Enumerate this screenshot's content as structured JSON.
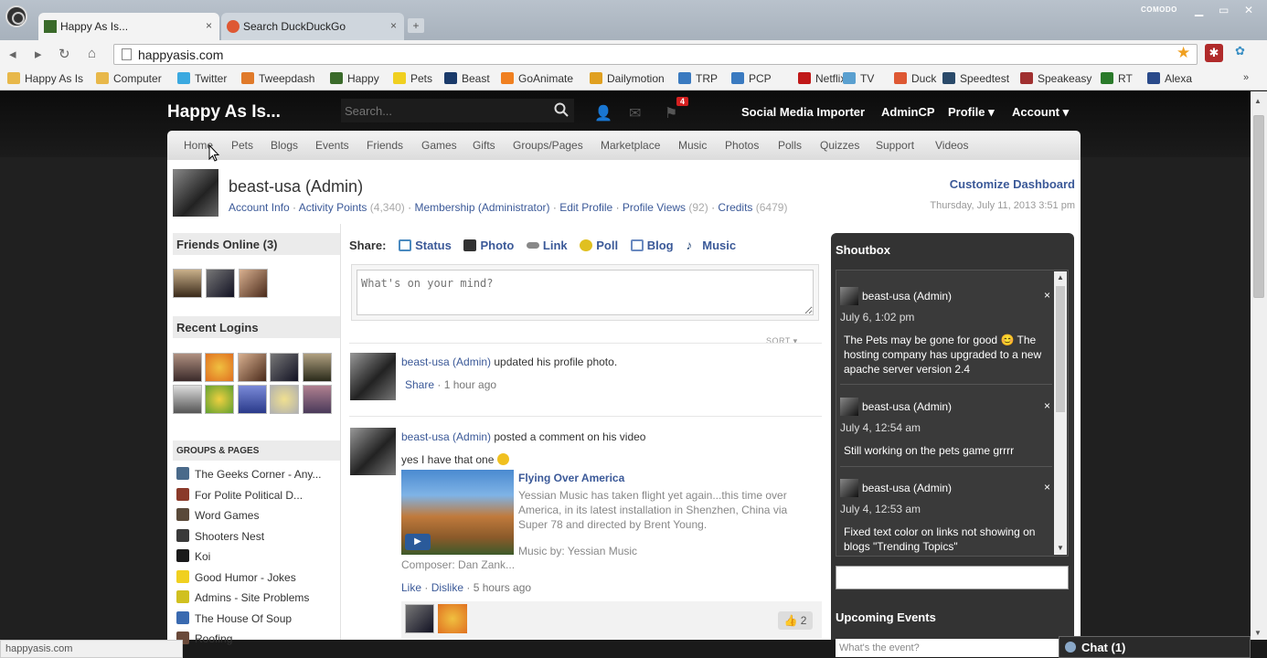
{
  "browser": {
    "tabs": [
      {
        "title": "Happy As Is...",
        "active": true
      },
      {
        "title": "Search DuckDuckGo",
        "active": false
      }
    ],
    "close_glyph": "×",
    "new_tab_glyph": "+",
    "brand": "COMODO",
    "url": "happyasis.com",
    "bookmarks": [
      {
        "label": "Happy As Is",
        "icon": "folder-icon",
        "color": "#e8b84a"
      },
      {
        "label": "Computer",
        "icon": "folder-icon",
        "color": "#e8b84a"
      },
      {
        "label": "Twitter",
        "icon": "twitter-icon",
        "color": "#3ba9e0"
      },
      {
        "label": "Tweepdash",
        "icon": "tweepdash-icon",
        "color": "#e07a2a"
      },
      {
        "label": "Happy",
        "icon": "happy-icon",
        "color": "#3a6a2a"
      },
      {
        "label": "Pets",
        "icon": "smiley-icon",
        "color": "#f0d020"
      },
      {
        "label": "Beast",
        "icon": "beast-icon",
        "color": "#1a3a6a"
      },
      {
        "label": "GoAnimate",
        "icon": "goanimate-icon",
        "color": "#f08020"
      },
      {
        "label": "Dailymotion",
        "icon": "dailymotion-icon",
        "color": "#e0a020"
      },
      {
        "label": "TRP",
        "icon": "trp-icon",
        "color": "#3a7ac0"
      },
      {
        "label": "PCP",
        "icon": "pcp-icon",
        "color": "#3a7ac0"
      },
      {
        "label": "Netflix",
        "icon": "netflix-icon",
        "color": "#c01818"
      },
      {
        "label": "TV",
        "icon": "tv-icon",
        "color": "#5aa0d0"
      },
      {
        "label": "Duck",
        "icon": "duck-icon",
        "color": "#de5833"
      },
      {
        "label": "Speedtest",
        "icon": "speedtest-icon",
        "color": "#2a4a6a"
      },
      {
        "label": "Speakeasy",
        "icon": "speakeasy-icon",
        "color": "#a03030"
      },
      {
        "label": "RT",
        "icon": "rt-icon",
        "color": "#2a7a2a"
      },
      {
        "label": "Alexa",
        "icon": "alexa-icon",
        "color": "#2a4a8a"
      }
    ],
    "more_glyph": "»",
    "status_url": "happyasis.com"
  },
  "header": {
    "site_title": "Happy As Is...",
    "search_placeholder": "Search...",
    "notif_count": "4",
    "links": [
      "Social Media Importer",
      "AdminCP",
      "Profile ▾",
      "Account ▾"
    ]
  },
  "nav": [
    "Home",
    "Pets",
    "Blogs",
    "Events",
    "Friends",
    "Games",
    "Gifts",
    "Groups/Pages",
    "Marketplace",
    "Music",
    "Photos",
    "Polls",
    "Quizzes",
    "Support",
    "Videos"
  ],
  "profile": {
    "name": "beast-usa (Admin)",
    "customize": "Customize Dashboard",
    "date": "Thursday, July 11, 2013 3:51 pm",
    "account_info": "Account Info",
    "activity_points": "Activity Points",
    "activity_count": "(4,340)",
    "membership": "Membership (Administrator)",
    "edit_profile": "Edit Profile",
    "profile_views": "Profile Views",
    "views_count": "(92)",
    "credits": "Credits",
    "credits_count": "(6479)",
    "sep": " · "
  },
  "friends_online": {
    "title": "Friends Online (3)"
  },
  "recent_logins": {
    "title": "Recent Logins"
  },
  "groups": {
    "title": "GROUPS & PAGES",
    "items": [
      {
        "label": "The Geeks Corner - Any...",
        "color": "#4a6a8a"
      },
      {
        "label": "For Polite Political D...",
        "color": "#8a3a2a"
      },
      {
        "label": "Word Games",
        "color": "#5a4a3a"
      },
      {
        "label": "Shooters Nest",
        "color": "#3a3a3a"
      },
      {
        "label": "Koi",
        "color": "#1a1a1a"
      },
      {
        "label": "Good Humor - Jokes",
        "color": "#f0d020"
      },
      {
        "label": "Admins - Site Problems",
        "color": "#d0c020"
      },
      {
        "label": "The House Of Soup",
        "color": "#3a6ab0"
      },
      {
        "label": "Roofing",
        "color": "#6a4a3a"
      }
    ]
  },
  "share": {
    "label": "Share:",
    "options": [
      {
        "label": "Status",
        "color": "#4a8ac0"
      },
      {
        "label": "Photo",
        "color": "#333"
      },
      {
        "label": "Link",
        "color": "#777"
      },
      {
        "label": "Poll",
        "color": "#e0c020"
      },
      {
        "label": "Blog",
        "color": "#6a8ac0"
      },
      {
        "label": "Music",
        "color": "#2a4a7a"
      }
    ],
    "placeholder": "What's on your mind?",
    "sort": "SORT ▾"
  },
  "feed": {
    "post1": {
      "author": "beast-usa (Admin)",
      "action": " updated his profile photo.",
      "share": "Share",
      "time": " · 1 hour ago"
    },
    "post2": {
      "author": "beast-usa (Admin)",
      "action": " posted a comment on his video",
      "comment": "yes I have that one",
      "video_title": "Flying Over America",
      "video_desc": "Yessian Music has taken flight yet again...this time over America, in its latest installation in Shenzhen, China via Super 78 and directed by Brent Young.",
      "music_by": "Music by: Yessian Music",
      "composer": "Composer: Dan Zank...",
      "like": "Like",
      "dislike": "Dislike",
      "time": " · 5 hours ago",
      "like_count": "2"
    }
  },
  "shoutbox": {
    "title": "Shoutbox",
    "shouts": [
      {
        "name": "beast-usa (Admin)",
        "date": "July 6, 1:02 pm",
        "msg": "The Pets may be gone for good 😊 The hosting company has upgraded to a new apache server version 2.4"
      },
      {
        "name": "beast-usa (Admin)",
        "date": "July 4, 12:54 am",
        "msg": "Still working on the pets game grrrr"
      },
      {
        "name": "beast-usa (Admin)",
        "date": "July 4, 12:53 am",
        "msg": "Fixed text color on links not showing on blogs \"Trending Topics\""
      }
    ],
    "close_glyph": "×"
  },
  "events": {
    "title": "Upcoming Events",
    "placeholder": "What's the event?"
  },
  "chat": {
    "label": "Chat (1)"
  }
}
